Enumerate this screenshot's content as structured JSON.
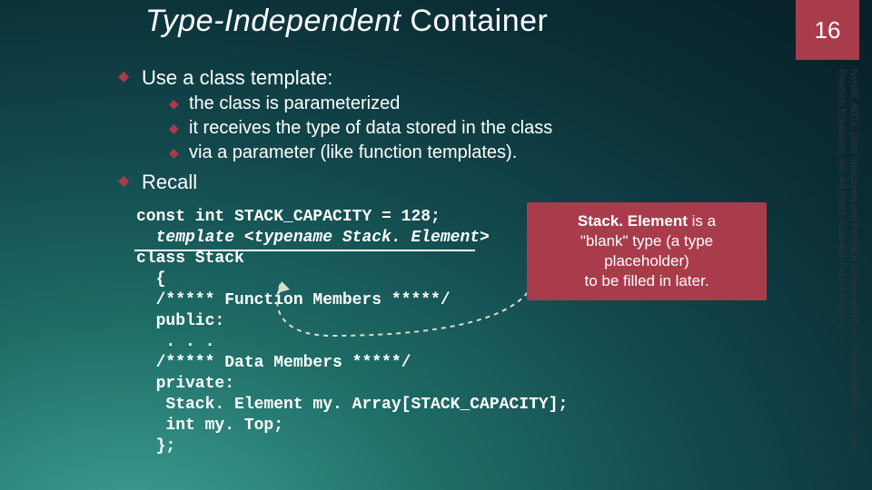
{
  "page_number": "16",
  "title": {
    "italic": "Type-Independent",
    "rest": " Container"
  },
  "copyright": "Nyhoff, ADTs, Data Structures and Problem Solving with C++, Second Edition, © 2005 Pearson Education, Inc. All rights reserved. 0-13-140909-3",
  "bullets": {
    "lvl1_a": "Use a class template:",
    "lvl2_a": "the class is parameterized",
    "lvl2_b": "it receives the type of data stored in the class",
    "lvl2_c": "via a parameter (like function templates).",
    "lvl1_b": "Recall"
  },
  "code": {
    "l1": "const int STACK_CAPACITY = 128;",
    "l2": "  template <typename Stack. Element>",
    "l3": "class Stack",
    "l4": "  {",
    "l5": "  /***** Function Members *****/",
    "l6": "  public:",
    "l7": "   . . .",
    "l8": "  /***** Data Members *****/",
    "l9": "  private:",
    "l10": "   Stack. Element my. Array[STACK_CAPACITY];",
    "l11": "   int my. Top;",
    "l12": "  };"
  },
  "callout": {
    "line1a": "Stack. Element",
    "line1b": " is a",
    "line2": "\"blank\" type (a type",
    "line3": "placeholder)",
    "line4": "to be filled in later."
  }
}
